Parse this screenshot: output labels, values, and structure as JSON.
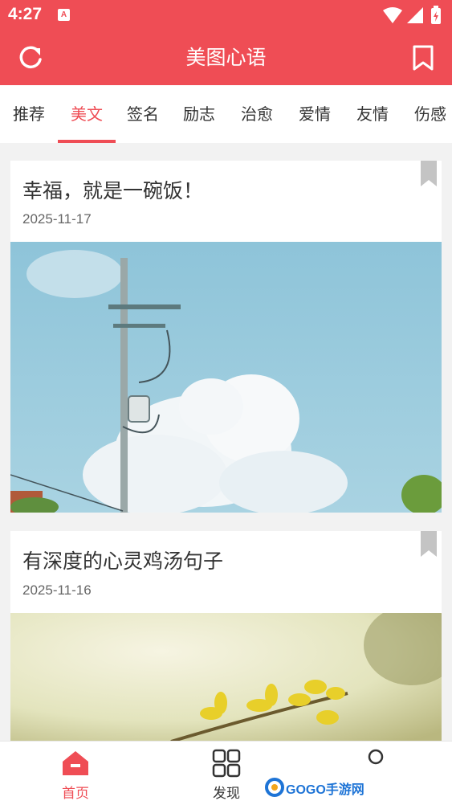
{
  "status": {
    "time": "4:27",
    "notification_letter": "A"
  },
  "header": {
    "title": "美图心语"
  },
  "tabs": [
    "推荐",
    "美文",
    "签名",
    "励志",
    "治愈",
    "爱情",
    "友情",
    "伤感"
  ],
  "active_tab": "美文",
  "colors": {
    "accent": "#ef4d55",
    "background": "#f2f2f2"
  },
  "articles": [
    {
      "title": "幸福，就是一碗饭！",
      "date": "2025-11-17",
      "image": "sky-utility-pole-photo"
    },
    {
      "title": "有深度的心灵鸡汤句子",
      "date": "2025-11-16",
      "image": "yellow-flowers-photo"
    }
  ],
  "bottom_nav": [
    {
      "label": "首页",
      "icon": "home-icon",
      "active": true
    },
    {
      "label": "发现",
      "icon": "discover-grid-icon",
      "active": false
    },
    {
      "label": "",
      "icon": "profile-icon",
      "active": false
    }
  ],
  "watermark": {
    "text": "GOGO手游网"
  }
}
